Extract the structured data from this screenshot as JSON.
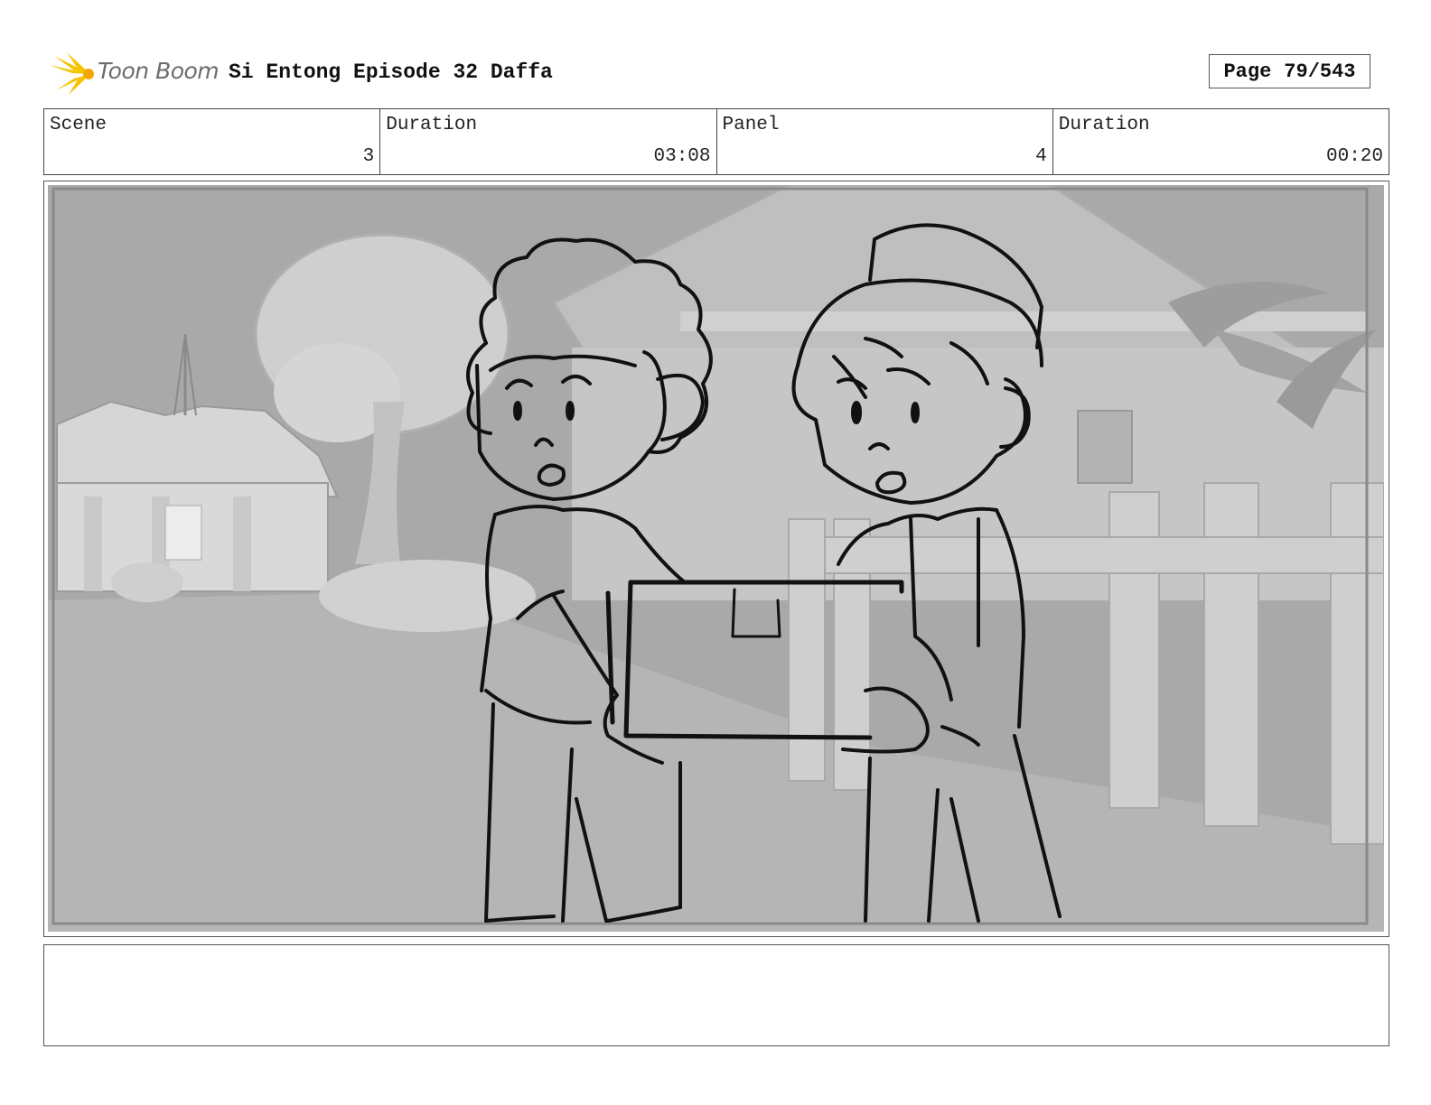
{
  "header": {
    "logo_text": "Toon Boom",
    "title": "Si Entong Episode 32 Daffa",
    "page_label": "Page",
    "page_value": "79/543"
  },
  "info": [
    {
      "label": "Scene",
      "value": "3"
    },
    {
      "label": "Duration",
      "value": "03:08"
    },
    {
      "label": "Panel",
      "value": "4"
    },
    {
      "label": "Duration",
      "value": "00:20"
    }
  ],
  "notes": {
    "text": ""
  },
  "colors": {
    "logo_accent": "#f5c400",
    "frame": "#555555"
  }
}
